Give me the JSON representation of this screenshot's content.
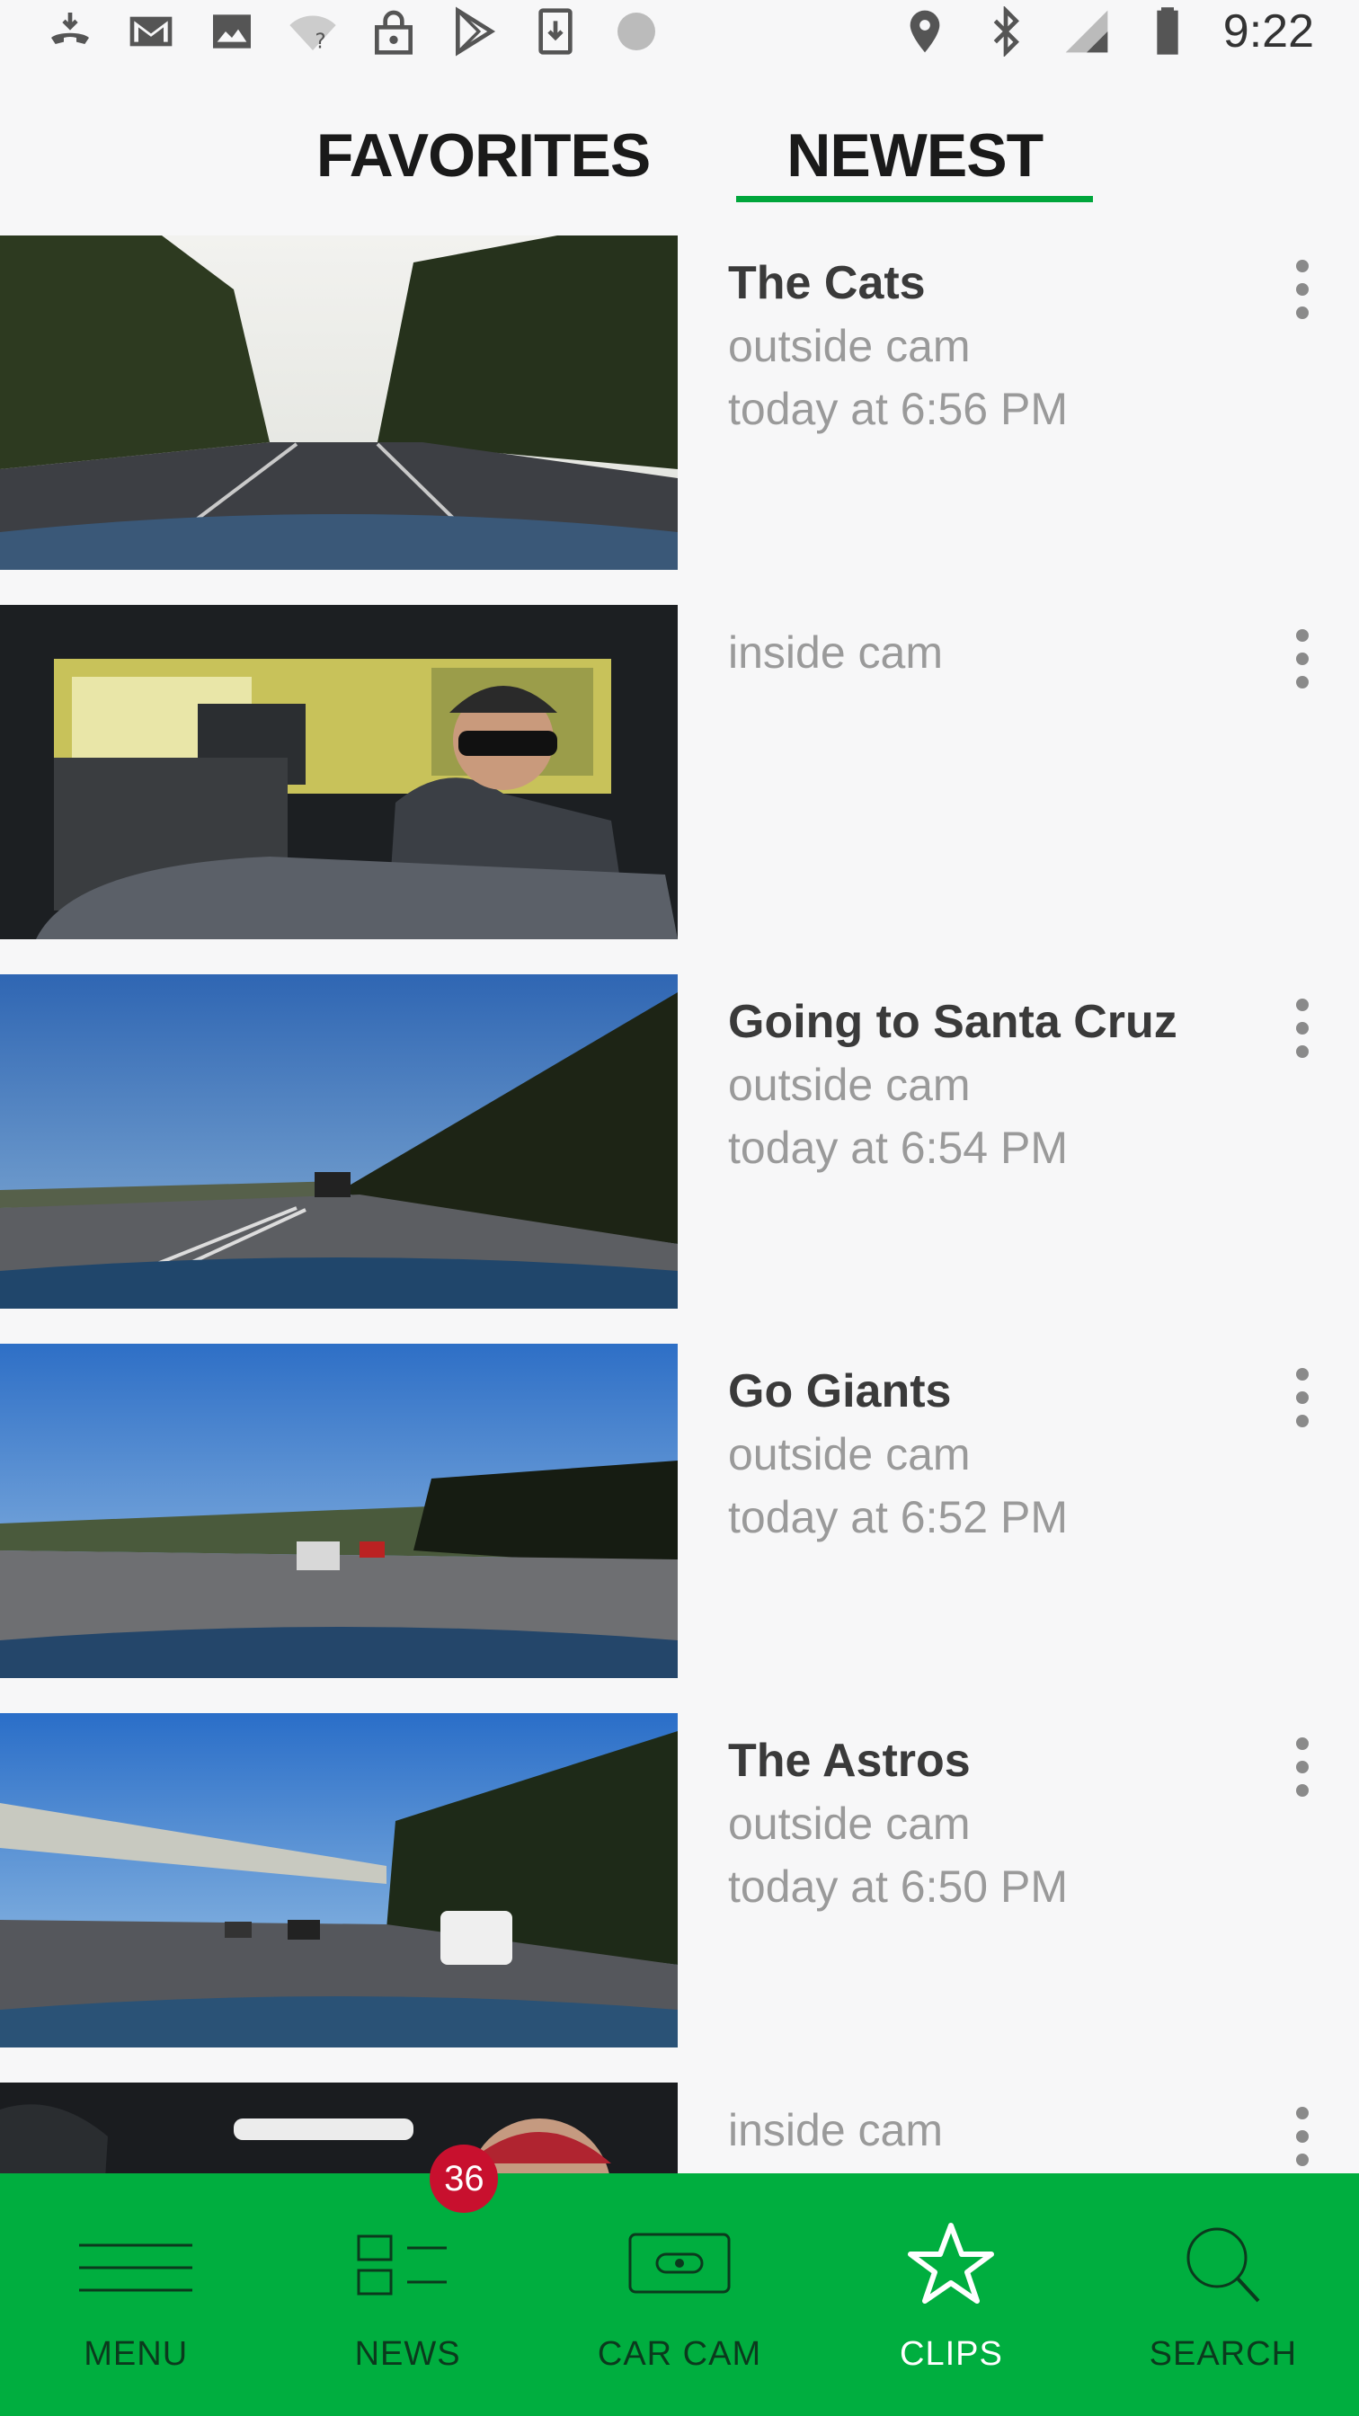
{
  "status_bar": {
    "time": "9:22",
    "left_icons": [
      "call-forward-icon",
      "gmail-icon",
      "image-icon",
      "wifi-question-icon",
      "lock-icon",
      "play-store-icon",
      "download-icon",
      "sync-icon"
    ],
    "right_icons": [
      "location-icon",
      "bluetooth-icon",
      "signal-lte-icon",
      "battery-icon"
    ]
  },
  "tabs": [
    {
      "label": "FAVORITES",
      "active": false
    },
    {
      "label": "NEWEST",
      "active": true
    }
  ],
  "clips": [
    {
      "title": "The Cats",
      "camera": "outside cam",
      "time": "today at 6:56 PM",
      "thumb": "road-trees"
    },
    {
      "title": "",
      "camera": "inside cam",
      "time": "",
      "thumb": "interior"
    },
    {
      "title": "Going to Santa Cruz",
      "camera": "outside cam",
      "time": "today at 6:54 PM",
      "thumb": "highway-hill"
    },
    {
      "title": "Go Giants",
      "camera": "outside cam",
      "time": "today at 6:52 PM",
      "thumb": "freeway"
    },
    {
      "title": "The Astros",
      "camera": "outside cam",
      "time": "today at 6:50 PM",
      "thumb": "overpass"
    },
    {
      "title": "",
      "camera": "inside cam",
      "time": "",
      "thumb": "interior-partial"
    }
  ],
  "bottom_nav": {
    "items": [
      {
        "label": "MENU",
        "icon": "hamburger-menu-icon",
        "active": false
      },
      {
        "label": "NEWS",
        "icon": "news-list-icon",
        "active": false,
        "badge": "36"
      },
      {
        "label": "CAR CAM",
        "icon": "car-cam-icon",
        "active": false
      },
      {
        "label": "CLIPS",
        "icon": "star-icon",
        "active": true
      },
      {
        "label": "SEARCH",
        "icon": "search-icon",
        "active": false
      }
    ]
  },
  "colors": {
    "accent": "#00ae3f",
    "tab_underline": "#00a63c",
    "badge": "#c8102e",
    "background": "#f7f7f8"
  }
}
